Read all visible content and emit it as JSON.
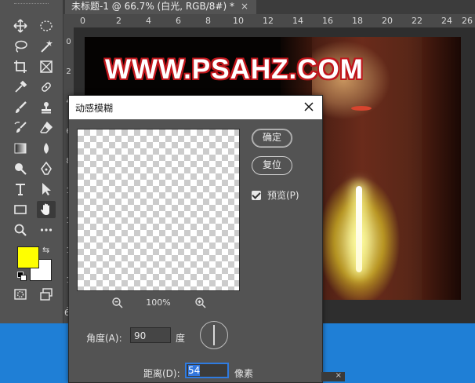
{
  "document_tab": {
    "title": "未标题-1 @ 66.7% (白光, RGB/8#) *",
    "close_glyph": "×"
  },
  "ruler": {
    "h_labels": [
      "0",
      "2",
      "4",
      "6",
      "8",
      "10",
      "12",
      "14",
      "16",
      "18",
      "20",
      "22",
      "24",
      "26"
    ],
    "v_labels": [
      "0",
      "2",
      "4",
      "6",
      "8",
      "1",
      "1",
      "1",
      "1",
      "1"
    ],
    "corner_marker": "6"
  },
  "canvas": {
    "watermark": "WWW.PSAHZ.COM"
  },
  "colors": {
    "foreground": "#ffff00",
    "background": "#ffffff",
    "watermark_outline": "#c0161c",
    "focus_accent": "#2f7be0"
  },
  "tools": [
    "move-icon",
    "marquee-icon",
    "lasso-icon",
    "magic-wand-icon",
    "crop-icon",
    "frame-icon",
    "eyedropper-icon",
    "healing-brush-icon",
    "brush-icon",
    "stamp-icon",
    "history-brush-icon",
    "eraser-icon",
    "gradient-icon",
    "blur-icon",
    "dodge-icon",
    "pen-icon",
    "type-icon",
    "path-select-icon",
    "rectangle-icon",
    "hand-icon",
    "zoom-icon",
    "more-icon"
  ],
  "dialog": {
    "title": "动感模糊",
    "ok_label": "确定",
    "reset_label": "复位",
    "preview_label": "预览(P)",
    "preview_checked": true,
    "zoom_level": "100%",
    "angle_label": "角度(A):",
    "angle_value": "90",
    "angle_unit": "度",
    "distance_label": "距离(D):",
    "distance_value": "54",
    "distance_unit": "像素"
  },
  "panel_strip": {
    "close_glyph": "×"
  }
}
